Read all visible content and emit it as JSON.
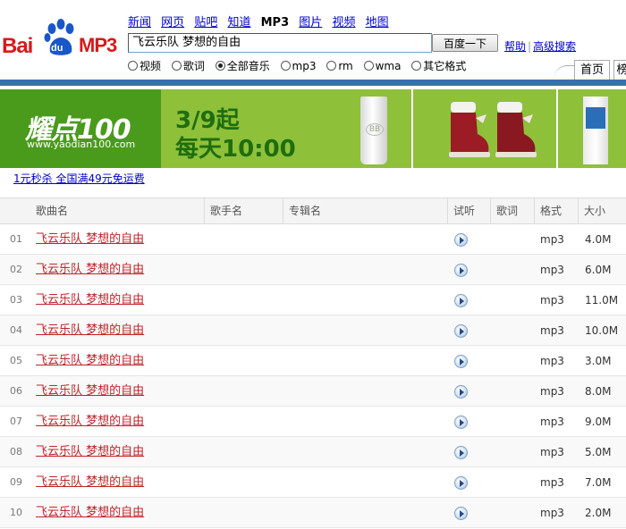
{
  "logo": {
    "bai": "Bai",
    "du": "du",
    "mp3": "MP3"
  },
  "nav": {
    "items": [
      "新闻",
      "网页",
      "贴吧",
      "知道",
      "MP3",
      "图片",
      "视频",
      "地图"
    ],
    "active": "MP3"
  },
  "search": {
    "query": "飞云乐队 梦想的自由",
    "button_label": "百度一下",
    "help_label": "帮助",
    "advanced_label": "高级搜索"
  },
  "filters": {
    "options": [
      "视频",
      "歌词",
      "全部音乐",
      "mp3",
      "rm",
      "wma",
      "其它格式"
    ],
    "selected": "全部音乐"
  },
  "tabs": {
    "home": "首页",
    "rank": "榜"
  },
  "banner": {
    "brand": "耀点100",
    "url": "www.yaodian100.com",
    "date": "3/9起",
    "daily": "每天10:00",
    "product_badge": "BB"
  },
  "promo": {
    "link_text": "1元秒杀 全国满49元免运费"
  },
  "table": {
    "headers": {
      "song": "歌曲名",
      "singer": "歌手名",
      "album": "专辑名",
      "listen": "试听",
      "lyrics": "歌词",
      "format": "格式",
      "size": "大小"
    },
    "rows": [
      {
        "num": "01",
        "song": "飞云乐队 梦想的自由",
        "format": "mp3",
        "size": "4.0M"
      },
      {
        "num": "02",
        "song": "飞云乐队 梦想的自由",
        "format": "mp3",
        "size": "6.0M"
      },
      {
        "num": "03",
        "song": "飞云乐队 梦想的自由",
        "format": "mp3",
        "size": "11.0M"
      },
      {
        "num": "04",
        "song": "飞云乐队 梦想的自由",
        "format": "mp3",
        "size": "10.0M"
      },
      {
        "num": "05",
        "song": "飞云乐队 梦想的自由",
        "format": "mp3",
        "size": "3.0M"
      },
      {
        "num": "06",
        "song": "飞云乐队 梦想的自由",
        "format": "mp3",
        "size": "8.0M"
      },
      {
        "num": "07",
        "song": "飞云乐队 梦想的自由",
        "format": "mp3",
        "size": "9.0M"
      },
      {
        "num": "08",
        "song": "飞云乐队 梦想的自由",
        "format": "mp3",
        "size": "5.0M"
      },
      {
        "num": "09",
        "song": "飞云乐队 梦想的自由",
        "format": "mp3",
        "size": "7.0M"
      },
      {
        "num": "10",
        "song": "飞云乐队 梦想的自由",
        "format": "mp3",
        "size": "2.0M"
      }
    ]
  },
  "colors": {
    "brand_red": "#d71a1b",
    "link_blue": "#0000cc",
    "song_red": "#c0242b",
    "header_bar": "#3a6fae",
    "banner_green": "#8ec03a"
  }
}
